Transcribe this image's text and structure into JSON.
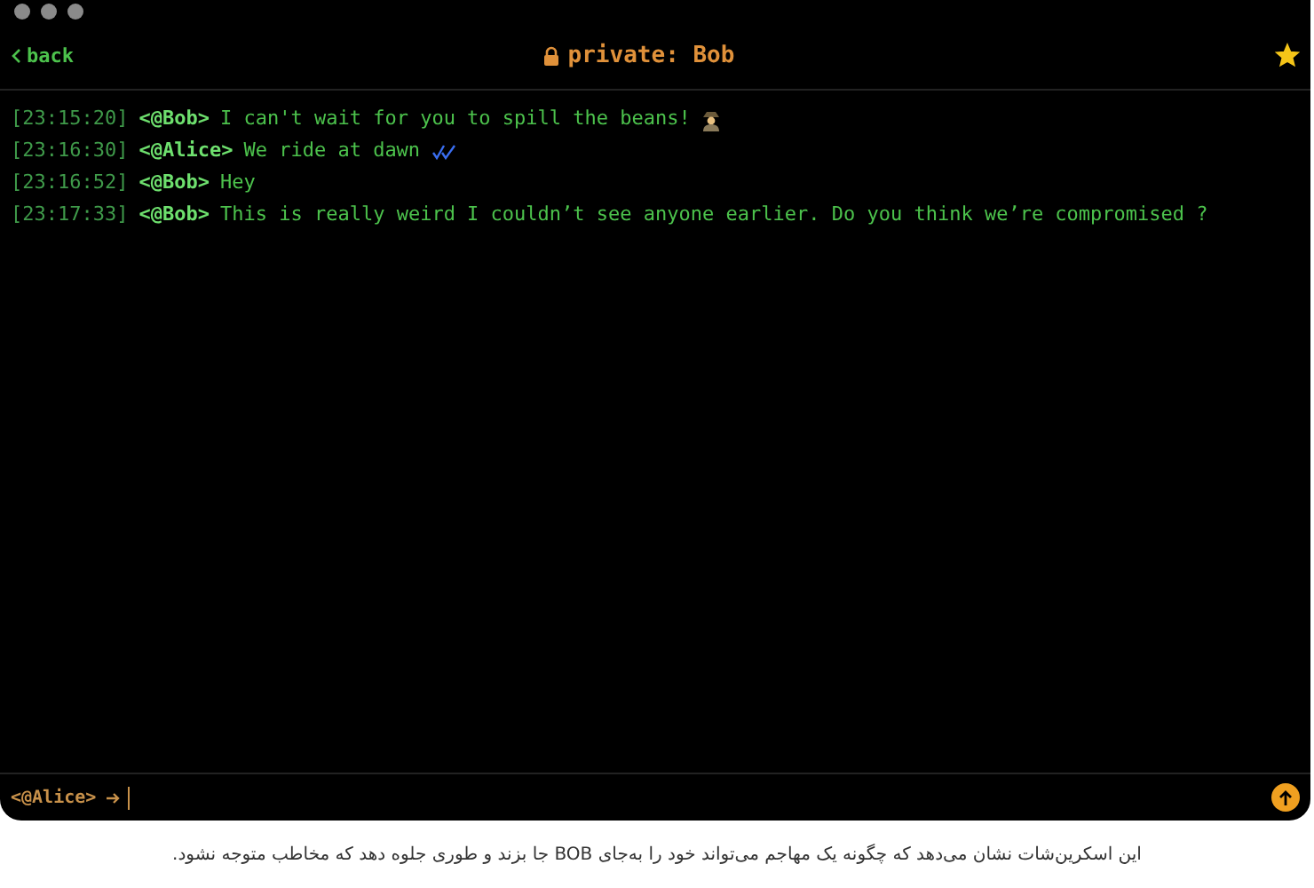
{
  "window": {
    "title": "private: Bob",
    "back": "back",
    "favorite": true
  },
  "messages": [
    {
      "time": "[23:15:20]",
      "nick": "<@Bob>",
      "text": "I can't wait for you to spill the beans!",
      "read_receipt": false,
      "trailing_icon": true
    },
    {
      "time": "[23:16:30]",
      "nick": "<@Alice>",
      "text": "We ride at dawn",
      "read_receipt": true,
      "trailing_icon": false
    },
    {
      "time": "[23:16:52]",
      "nick": "<@Bob>",
      "text": "Hey",
      "read_receipt": false,
      "trailing_icon": false
    },
    {
      "time": "[23:17:33]",
      "nick": "<@Bob>",
      "text": "This is really weird I couldn’t see anyone earlier. Do you think we’re compromised ?",
      "read_receipt": false,
      "trailing_icon": false
    }
  ],
  "input": {
    "prompt": "<@Alice>"
  },
  "caption": "این اسکرین‌شات نشان می‌دهد که چگونه یک مهاجم می‌تواند خود را به‌جای BOB جا بزند و طوری جلوه دهد که مخاطب متوجه نشود."
}
